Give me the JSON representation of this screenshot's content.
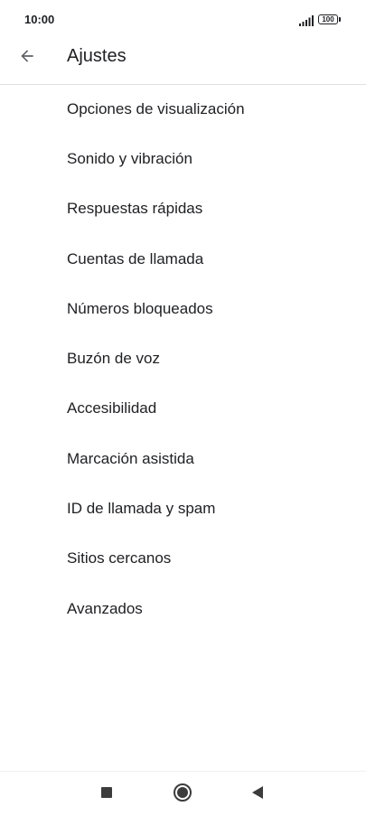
{
  "status_bar": {
    "time": "10:00",
    "battery": "100",
    "icons": [
      "signal-icon",
      "battery-icon"
    ]
  },
  "app_bar": {
    "title": "Ajustes",
    "back_icon": "arrow-back-icon"
  },
  "settings": {
    "items": [
      {
        "label": "Opciones de visualización"
      },
      {
        "label": "Sonido y vibración"
      },
      {
        "label": "Respuestas rápidas"
      },
      {
        "label": "Cuentas de llamada"
      },
      {
        "label": "Números bloqueados"
      },
      {
        "label": "Buzón de voz"
      },
      {
        "label": "Accesibilidad"
      },
      {
        "label": "Marcación asistida"
      },
      {
        "label": "ID de llamada y spam"
      },
      {
        "label": "Sitios cercanos"
      },
      {
        "label": "Avanzados"
      }
    ]
  },
  "nav_bar": {
    "icons": [
      "recents-square-icon",
      "home-circle-icon",
      "back-triangle-icon"
    ]
  },
  "colors": {
    "text": "#202124",
    "icon": "#5f6368",
    "divider": "#e0e0e0",
    "background": "#ffffff",
    "nav_icon": "#3c3c3c"
  }
}
